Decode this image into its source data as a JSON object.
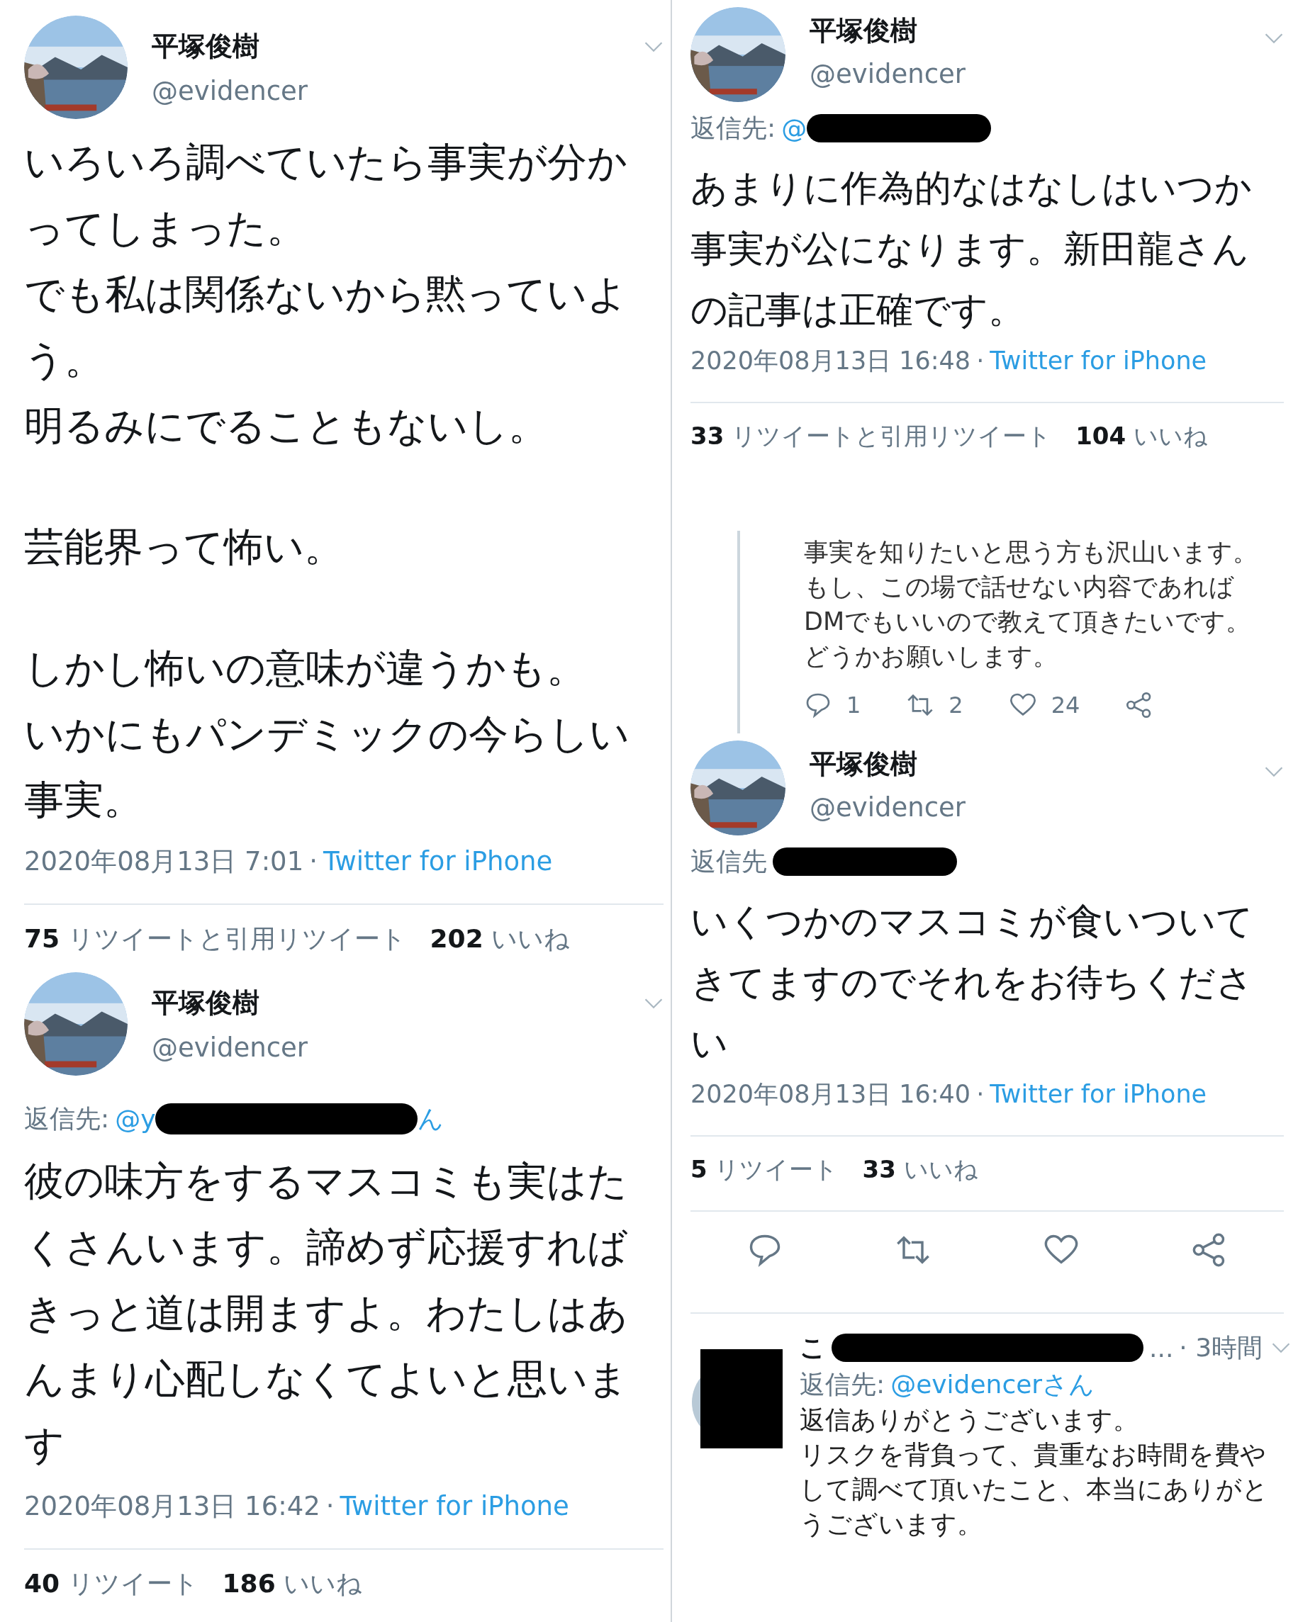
{
  "left_column": [
    {
      "kind": "tweet",
      "name": "平塚俊樹",
      "handle": "@evidencer",
      "paragraphs": [
        [
          "いろいろ調べていたら事実が分か",
          "ってしまった。",
          "でも私は関係ないから黙っていよ",
          "う。",
          "明るみにでることもないし。"
        ],
        [
          "芸能界って怖い。"
        ],
        [
          "しかし怖いの意味が違うかも。",
          "いかにもパンデミックの今らしい",
          "事実。"
        ]
      ],
      "date": "2020年08月13日 7:01",
      "separator": "·",
      "source": "Twitter for iPhone",
      "stats": [
        {
          "count": "75",
          "label": "リツイートと引用リツイート"
        },
        {
          "count": "202",
          "label": "いいね"
        }
      ]
    },
    {
      "kind": "tweet",
      "name": "平塚俊樹",
      "handle": "@evidencer",
      "reply_to": {
        "label": "返信先:",
        "handle_start": "@y",
        "handle_end": "ん",
        "redacted": true
      },
      "paragraphs": [
        [
          "彼の味方をするマスコミも実はた",
          "くさんいます。諦めず応援すれば",
          "きっと道は開ますよ。わたしはあ",
          "んまり心配しなくてよいと思いま",
          "す"
        ]
      ],
      "date": "2020年08月13日 16:42",
      "separator": "·",
      "source": "Twitter for iPhone",
      "stats": [
        {
          "count": "40",
          "label": "リツイート"
        },
        {
          "count": "186",
          "label": "いいね"
        }
      ]
    }
  ],
  "right_column": [
    {
      "kind": "tweet",
      "name": "平塚俊樹",
      "handle": "@evidencer",
      "reply_to": {
        "label": "返信先:",
        "handle_start": "@",
        "redacted": true
      },
      "paragraphs": [
        [
          "あまりに作為的なはなしはいつか",
          "事実が公になります。新田龍さん",
          "の記事は正確です。"
        ]
      ],
      "date": "2020年08月13日 16:48",
      "separator": "·",
      "source": "Twitter for iPhone",
      "stats": [
        {
          "count": "33",
          "label": "リツイートと引用リツイート"
        },
        {
          "count": "104",
          "label": "いいね"
        }
      ]
    },
    {
      "kind": "reply_card",
      "lines": [
        "事実を知りたいと思う方も沢山います。",
        "もし、この場で話せない内容であれば",
        "DMでもいいので教えて頂きたいです。",
        "どうかお願いします。"
      ],
      "actions": [
        {
          "kind": "reply",
          "count": "1"
        },
        {
          "kind": "retweet",
          "count": "2"
        },
        {
          "kind": "like",
          "count": "24"
        },
        {
          "kind": "share"
        }
      ]
    },
    {
      "kind": "tweet",
      "name": "平塚俊樹",
      "handle": "@evidencer",
      "reply_to": {
        "label": "返信先",
        "redacted": true
      },
      "paragraphs": [
        [
          "いくつかのマスコミが食いついて",
          "きてますのでそれをお待ちくださ",
          "い"
        ]
      ],
      "date": "2020年08月13日 16:40",
      "separator": "·",
      "source": "Twitter for iPhone",
      "stats": [
        {
          "count": "5",
          "label": "リツイート"
        },
        {
          "count": "33",
          "label": "いいね"
        }
      ],
      "actions": [
        {
          "kind": "reply"
        },
        {
          "kind": "retweet"
        },
        {
          "kind": "like"
        },
        {
          "kind": "share"
        }
      ]
    },
    {
      "kind": "reply",
      "avatar_redacted": true,
      "name_start": "こ",
      "name_redacted": true,
      "ellipsis": "...",
      "time": "· 3時間",
      "reply_to": {
        "label": "返信先:",
        "handle": "@evidencerさん"
      },
      "lines": [
        "返信ありがとうございます。",
        "リスクを背負って、貴重なお時間を費や",
        "して調べて頂いたこと、本当にありがと",
        "うございます。"
      ]
    }
  ]
}
